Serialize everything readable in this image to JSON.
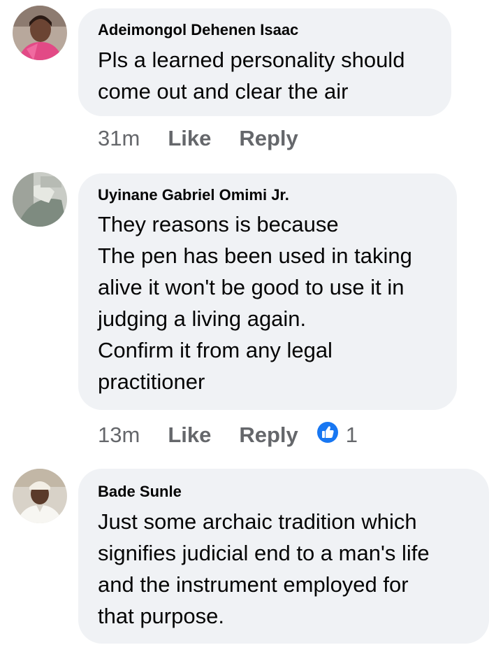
{
  "comments": [
    {
      "author": "Adeimongol Dehenen Isaac",
      "text": "Pls a learned personality should\ncome out and clear the air",
      "time": "31m",
      "like": "Like",
      "reply": "Reply",
      "avatar": "avatar-woman"
    },
    {
      "author": "Uyinane Gabriel Omimi Jr.",
      "text": "They reasons is because\nThe pen has been used in taking\nalive it won't be good to use it in\njudging a living again.\n Confirm it from any legal\npractitioner",
      "time": "13m",
      "like": "Like",
      "reply": "Reply",
      "reaction_count": "1",
      "reaction_icon": "thumbs-up-icon",
      "avatar": "avatar-man-grey"
    },
    {
      "author": "Bade Sunle",
      "text": "Just some archaic tradition which\nsignifies judicial end to a man's life\nand the instrument employed for\nthat purpose.",
      "avatar": "avatar-man-white-cap"
    }
  ],
  "colors": {
    "bubble": "#f0f2f5",
    "meta": "#65676b",
    "like_blue": "#1877f2"
  }
}
